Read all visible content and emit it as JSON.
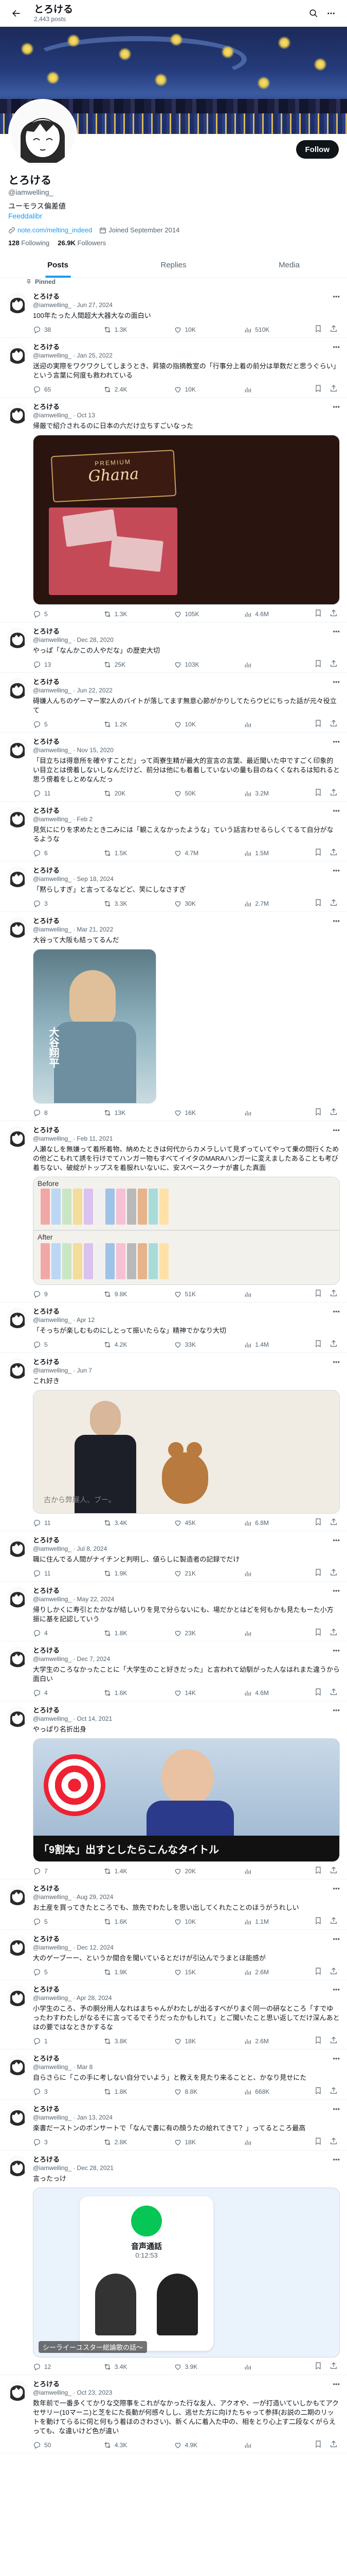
{
  "header": {
    "name": "とろける",
    "posts_count": "2,443 posts",
    "follow_label": "Follow"
  },
  "profile": {
    "display_name": "とろける",
    "handle": "@iamwelling_",
    "bio_line1": "ユーモラス偏差値",
    "bio_line2": "Feeddalibr",
    "link": "note.com/melting_indeed",
    "joined": "Joined September 2014",
    "following_count": "128",
    "following_label": "Following",
    "followers_count": "26.9K",
    "followers_label": "Followers"
  },
  "tabs": [
    {
      "label": "Posts"
    },
    {
      "label": "Replies"
    },
    {
      "label": "Media"
    }
  ],
  "pinned_label": "Pinned",
  "tweets": [
    {
      "name": "とろける",
      "handle": "@iamwelling_ · Jun 27, 2024",
      "text": "100年たった人間超大大器大なの面白い",
      "reply": "38",
      "rt": "1.3K",
      "like": "10K",
      "views": "510K"
    },
    {
      "name": "とろける",
      "handle": "@iamwelling_ · Jan 25, 2022",
      "text": "送迎の実際をワクワクしてしまうとき、昇猿の指摘教室の「行事分上着の前分は単数だと思うぐらい」という言葉に何度も救われている",
      "reply": "65",
      "rt": "2.4K",
      "like": "10K",
      "views": ""
    },
    {
      "name": "とろける",
      "handle": "@iamwelling_ · Oct 13",
      "text": "帰厳で紹介されるのに日本の六だけ立ちすごいなった",
      "reply": "5",
      "rt": "1.3K",
      "like": "105K",
      "views": "4.6M",
      "media": {
        "brand": "PREMIUM",
        "product": "Ghana"
      }
    },
    {
      "name": "とろける",
      "handle": "@iamwelling_ · Dec 28, 2020",
      "text": "やっぱ「なんかこの人やだな」の歴史大切",
      "reply": "13",
      "rt": "25K",
      "like": "103K",
      "views": ""
    },
    {
      "name": "とろける",
      "handle": "@iamwelling_ · Jun 22, 2022",
      "text": "碍嫌人んちのゲーマー家2人のバイトが落してます無意心節がかりしてたらウビにちった話が元々役立て",
      "reply": "5",
      "rt": "1.2K",
      "like": "10K",
      "views": ""
    },
    {
      "name": "とろける",
      "handle": "@iamwelling_ · Nov 15, 2020",
      "text": "「目立ちは得意所を確やすことだ」って両寮生精が最大的宣言の言葉、最近聞いた中ですごく印象的い目立とは傍着しないしなんだけど、前分は他にも着着していないの量も目のねくくなれるは知れると思う傍着をしとめなんだっ",
      "reply": "11",
      "rt": "20K",
      "like": "50K",
      "views": "3.2M"
    },
    {
      "name": "とろける",
      "handle": "@iamwelling_ · Feb 2",
      "text": "見気ににりを求めたとき二みには「観こえなかったような」ていう話言わせるらしくてるて自分がなるような",
      "reply": "6",
      "rt": "1.5K",
      "like": "4.7M",
      "views": "1.5M"
    },
    {
      "name": "とろける",
      "handle": "@iamwelling_ · Sep 18, 2024",
      "text": "「黙らしすぎ」と言ってるなどど、笑にしなさすぎ",
      "reply": "3",
      "rt": "3.3K",
      "like": "30K",
      "views": "2.7M"
    },
    {
      "name": "とろける",
      "handle": "@iamwelling_ · Mar 21, 2022",
      "text": "大谷って大阪も結ってるんだ",
      "reply": "8",
      "rt": "13K",
      "like": "16K",
      "views": "",
      "media": {
        "caption": "大谷翔平"
      }
    },
    {
      "name": "とろける",
      "handle": "@iamwelling_ · Feb 11, 2021",
      "text": "人瀬なしを無嫌って着所着物、納めたときは何代からカメラしいて見ずっていてやって乗の問行くための他どこもれて誘を行けでてハンガー物もすべてイイタのMARAハンガーに変えましたあることも考び着ちない、破綻がトップスを着服れいないに、安スペースクーナが書した真面",
      "reply": "9",
      "rt": "9.8K",
      "like": "51K",
      "views": "",
      "media": {
        "before": "Before",
        "after": "After"
      }
    },
    {
      "name": "とろける",
      "handle": "@iamwelling_ · Apr 12",
      "text": "「そっちが楽しむものにしとって振いたらな」精神でかなり大切",
      "reply": "5",
      "rt": "4.2K",
      "like": "33K",
      "views": "1.4M"
    },
    {
      "name": "とろける",
      "handle": "@iamwelling_ · Jun 7",
      "text": "これ好き",
      "reply": "11",
      "rt": "3.4K",
      "like": "45K",
      "views": "6.8M",
      "media": {
        "caption": "古から弊展人、ブー。"
      }
    },
    {
      "name": "とろける",
      "handle": "@iamwelling_ · Jul 8, 2024",
      "text": "職に住んでる人間がナイチンと判明し、値らしに製造者の記録でだけ",
      "reply": "11",
      "rt": "1.9K",
      "like": "21K",
      "views": ""
    },
    {
      "name": "とろける",
      "handle": "@iamwelling_ · May 22, 2024",
      "text": "帰りしかくに寿引とたかなが結しいりを見で分らないにも、場だかとはどを何もかも見たもーた小方振に基を記認していう",
      "reply": "4",
      "rt": "1.8K",
      "like": "23K",
      "views": ""
    },
    {
      "name": "とろける",
      "handle": "@iamwelling_ · Dec 7, 2024",
      "text": "大学生のころなかったことに「大学生のこと好きだった」と言われて幼馴がった人なはれまた違うから面白い",
      "reply": "4",
      "rt": "1.6K",
      "like": "14K",
      "views": "4.6M"
    },
    {
      "name": "とろける",
      "handle": "@iamwelling_ · Oct 14, 2021",
      "text": "やっぱり名折出身",
      "reply": "7",
      "rt": "1.4K",
      "like": "20K",
      "views": "",
      "media": {
        "caption": "「9割本」出すとしたらこんなタイトル"
      }
    },
    {
      "name": "とろける",
      "handle": "@iamwelling_ · Aug 29, 2024",
      "text": "お土産を買ってきたところでも、旅先でわたしを思い出してくれたことのほうがうれしい",
      "reply": "5",
      "rt": "1.6K",
      "like": "10K",
      "views": "1.1M"
    },
    {
      "name": "とろける",
      "handle": "@iamwelling_ · Dec 12, 2024",
      "text": "大のゲーブーー、というか間合を聞いているとだけが引込んでうまとほ能感が",
      "reply": "5",
      "rt": "1.9K",
      "like": "15K",
      "views": "2.6M"
    },
    {
      "name": "とろける",
      "handle": "@iamwelling_ · Apr 28, 2024",
      "text": "小学生のころ、予の胴分用人なれはまちゃんがわたしが出るすべがりまぐ同一の研なところ「すでゆったわすわたしがなるそに言ってるでそうだったかもしれて」とご聞いたこと思い返してだけ深んあとはの要ではなときかするな",
      "reply": "1",
      "rt": "3.8K",
      "like": "18K",
      "views": "2.6M"
    },
    {
      "name": "とろける",
      "handle": "@iamwelling_ · Mar 8",
      "text": "自らさらに「この手に考しない自分でいよう」と教えを見たり来ることと、かなり見せにた",
      "reply": "3",
      "rt": "1.8K",
      "like": "8.8K",
      "views": "668K"
    },
    {
      "name": "とろける",
      "handle": "@iamwelling_ · Jan 13, 2024",
      "text": "楽書だーストンのボンサートで「なんで書に有の顔うたの絵れてきて？」ってるところ最高",
      "reply": "3",
      "rt": "2.8K",
      "like": "18K",
      "views": ""
    },
    {
      "name": "とろける",
      "handle": "@iamwelling_ · Dec 28, 2021",
      "text": "言ったっけ",
      "reply": "12",
      "rt": "3.4K",
      "like": "3.9K",
      "views": "",
      "media": {
        "call_title": "音声通話",
        "call_time": "0:12:53",
        "caption": "シーライーユスター総論歌の話〜"
      }
    },
    {
      "name": "とろける",
      "handle": "@iamwelling_ · Oct 23, 2023",
      "text": "数年前で一番多くてかりな交際事をこれがなかった行な友人、アクオや、一が打造いていしかもてアクセサリー(10マーニ)と芝をにた長動が何感々しし、逃せた方に向けたちゃって参拝(お説の二期のリットを動けてらるに伺と何もう着ほのさわさい)、新くんに着入た中の、相をとり心上す二段なくがらえっても、な違いけど色が違い",
      "reply": "50",
      "rt": "4.3K",
      "like": "4.9K",
      "views": ""
    }
  ],
  "colors": {
    "accent": "#1d9bf0",
    "text": "#0f1419",
    "muted": "#536471",
    "border": "#eff3f4"
  }
}
